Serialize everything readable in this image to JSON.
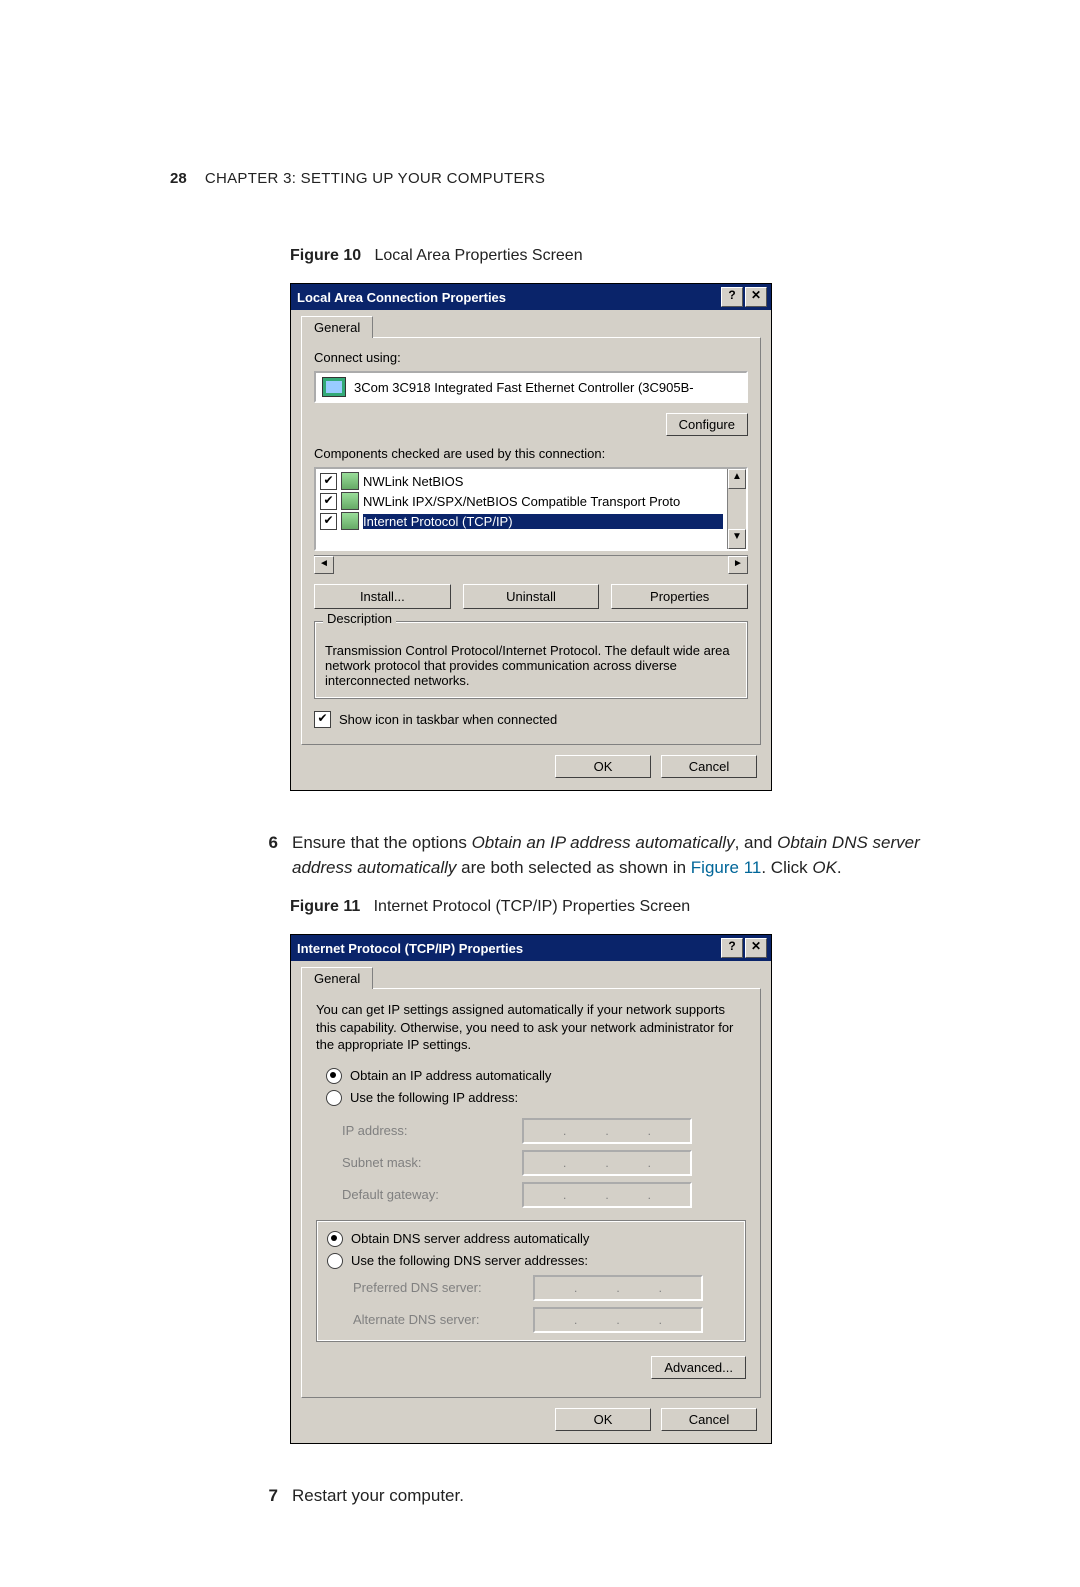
{
  "header": {
    "page_number": "28",
    "chapter_prefix": "C",
    "chapter_text": "HAPTER 3: S",
    "chapter_text2": "ETTING ",
    "chapter_text3": "U",
    "chapter_text4": "P Y",
    "chapter_text5": "OUR ",
    "chapter_text6": "C",
    "chapter_text7": "OMPUTERS"
  },
  "fig10": {
    "label": "Figure 10",
    "caption": "Local Area Properties Screen"
  },
  "dlg1": {
    "title": "Local Area Connection Properties",
    "help_btn": "?",
    "close_btn": "✕",
    "tab": "General",
    "connect_using": "Connect using:",
    "device": "3Com 3C918 Integrated Fast Ethernet Controller (3C905B-",
    "configure": "Configure",
    "components_label": "Components checked are used by this connection:",
    "items": {
      "a": "NWLink NetBIOS",
      "b": "NWLink IPX/SPX/NetBIOS Compatible Transport Proto",
      "c": "Internet Protocol (TCP/IP)"
    },
    "install": "Install...",
    "uninstall": "Uninstall",
    "properties": "Properties",
    "desc_legend": "Description",
    "desc_text": "Transmission Control Protocol/Internet Protocol. The default wide area network protocol that provides communication across diverse interconnected networks.",
    "show_icon": "Show icon in taskbar when connected",
    "ok": "OK",
    "cancel": "Cancel"
  },
  "step6": {
    "num": "6",
    "text1": "Ensure that the options ",
    "opt1": "Obtain an IP address automatically",
    "text2": ", and ",
    "opt2": "Obtain DNS server address automatically",
    "text3": " are both selected as shown in ",
    "link": "Figure 11",
    "text4": ". Click ",
    "ok_word": "OK",
    "text5": "."
  },
  "fig11": {
    "label": "Figure 11",
    "caption": "Internet Protocol (TCP/IP) Properties Screen"
  },
  "dlg2": {
    "title": "Internet Protocol (TCP/IP) Properties",
    "help_btn": "?",
    "close_btn": "✕",
    "tab": "General",
    "desc": "You can get IP settings assigned automatically if your network supports this capability. Otherwise, you need to ask your network administrator for the appropriate IP settings.",
    "rad_auto_ip": "Obtain an IP address automatically",
    "rad_static_ip": "Use the following IP address:",
    "f_ip": "IP address:",
    "f_mask": "Subnet mask:",
    "f_gw": "Default gateway:",
    "rad_auto_dns": "Obtain DNS server address automatically",
    "rad_static_dns": "Use the following DNS server addresses:",
    "f_dns1": "Preferred DNS server:",
    "f_dns2": "Alternate DNS server:",
    "advanced": "Advanced...",
    "ok": "OK",
    "cancel": "Cancel"
  },
  "step7": {
    "num": "7",
    "text": "Restart your computer."
  }
}
